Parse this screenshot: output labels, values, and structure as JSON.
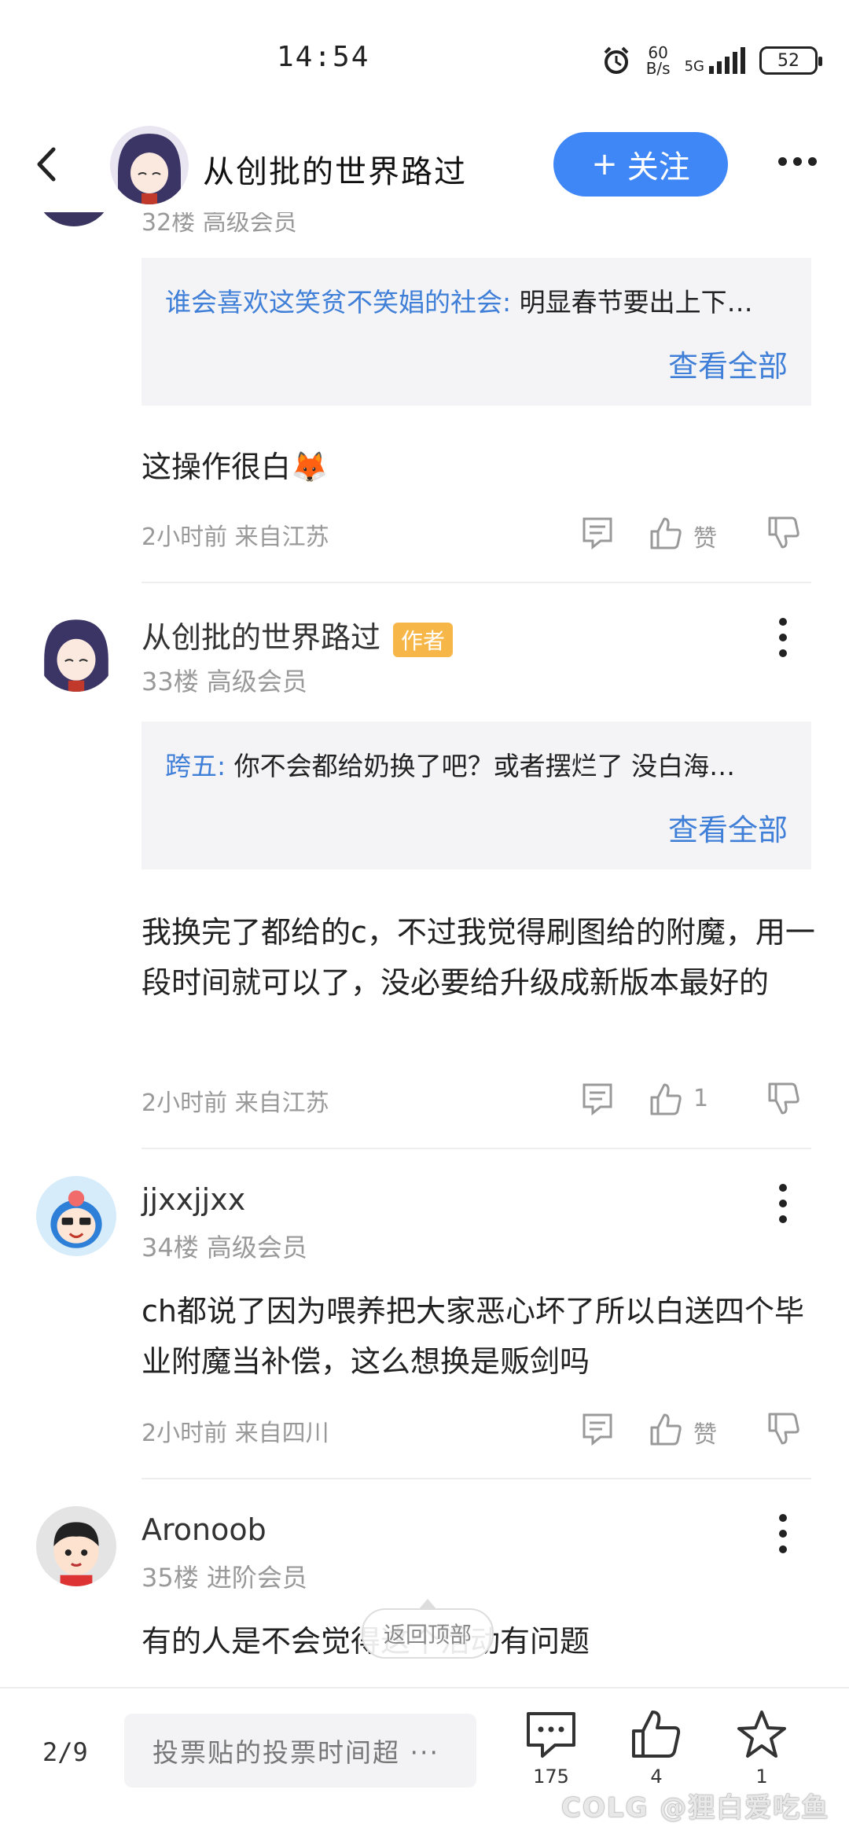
{
  "status_bar": {
    "time": "14:54",
    "net_speed_value": "60",
    "net_speed_unit": "B/s",
    "network": "5G",
    "battery": "52"
  },
  "header": {
    "title": "从创批的世界路过",
    "follow_label": "关注",
    "follow_prefix": "+"
  },
  "partial_prev_meta": "32楼 高级会员",
  "posts": [
    {
      "quote_user": "谁会喜欢这笑贫不笑娼的社会:",
      "quote_text": "明显春节要出上下…",
      "quote_more": "查看全部",
      "body": "这操作很白🦊",
      "meta": "2小时前 来自江苏",
      "like_label": "赞"
    },
    {
      "username": "从创批的世界路过",
      "badge": "作者",
      "level": "33楼 高级会员",
      "quote_user": "跨五:",
      "quote_text": "你不会都给奶换了吧？或者摆烂了 没白海…",
      "quote_more": "查看全部",
      "body": "我换完了都给的c，不过我觉得刷图给的附魔，用一段时间就可以了，没必要给升级成新版本最好的",
      "meta": "2小时前 来自江苏",
      "like_label": "1"
    },
    {
      "username": "jjxxjjxx",
      "level": "34楼 高级会员",
      "body": "ch都说了因为喂养把大家恶心坏了所以白送四个毕业附魔当补偿，这么想换是贩剑吗",
      "meta": "2小时前 来自四川",
      "like_label": "赞"
    },
    {
      "username": "Aronoob",
      "level": "35楼 进阶会员",
      "body": "有的人是不会觉得这个活动有问题"
    }
  ],
  "back_to_top": "返回顶部",
  "bottom_bar": {
    "page_indicator": "2/9",
    "input_placeholder": "投票贴的投票时间超 ···",
    "comment_count": "175",
    "like_count": "4",
    "favorite_count": "1"
  },
  "watermark": "COLG @狸白爱吃鱼",
  "colors": {
    "accent": "#3f86f6",
    "link": "#3f7fd8",
    "badge": "#f7b748"
  }
}
